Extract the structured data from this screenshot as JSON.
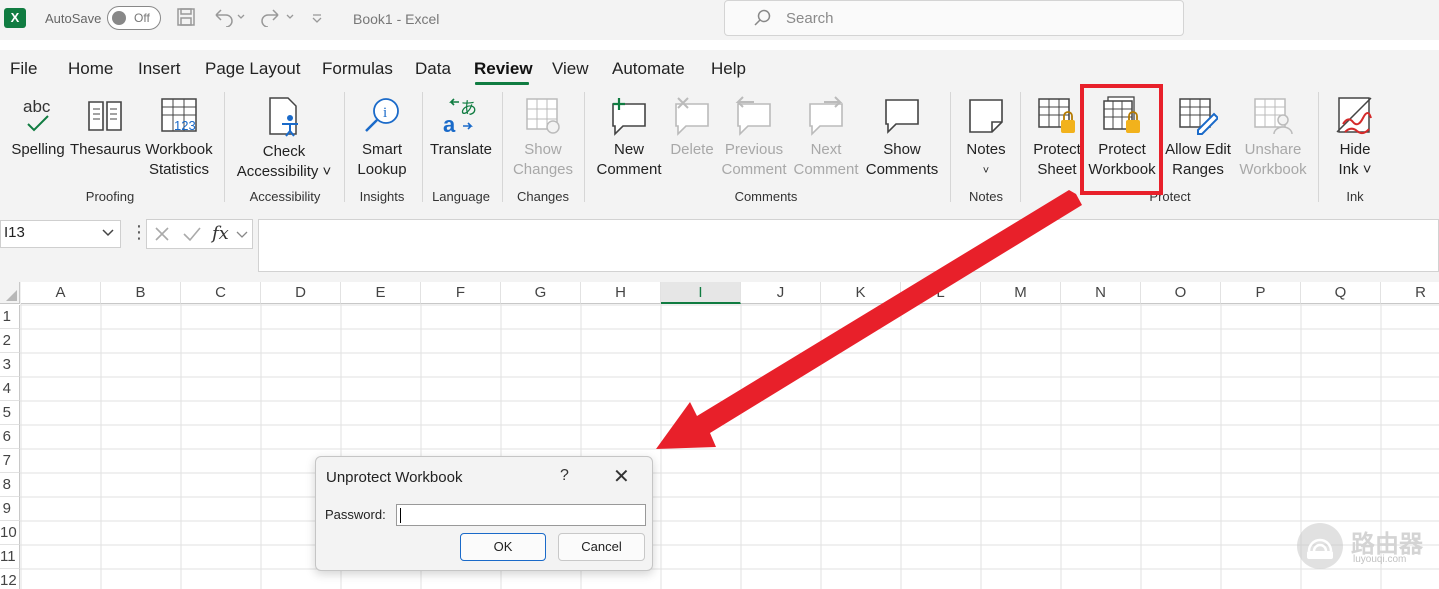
{
  "titlebar": {
    "app_icon": "X",
    "autosave_label": "AutoSave",
    "autosave_state": "Off",
    "doc_title": "Book1  -  Excel",
    "search_placeholder": "Search"
  },
  "menu": {
    "items": [
      "File",
      "Home",
      "Insert",
      "Page Layout",
      "Formulas",
      "Data",
      "Review",
      "View",
      "Automate",
      "Help"
    ],
    "active": "Review"
  },
  "ribbon": {
    "spelling": "Spelling",
    "thesaurus": "Thesaurus",
    "workbook_stats_1": "Workbook",
    "workbook_stats_2": "Statistics",
    "check_acc_1": "Check",
    "check_acc_2": "Accessibility ˅",
    "smart_1": "Smart",
    "smart_2": "Lookup",
    "translate": "Translate",
    "show_changes_1": "Show",
    "show_changes_2": "Changes",
    "new_comment_1": "New",
    "new_comment_2": "Comment",
    "delete": "Delete",
    "prev_1": "Previous",
    "prev_2": "Comment",
    "next_1": "Next",
    "next_2": "Comment",
    "show_comments_1": "Show",
    "show_comments_2": "Comments",
    "notes": "Notes",
    "protect_sheet_1": "Protect",
    "protect_sheet_2": "Sheet",
    "protect_wb_1": "Protect",
    "protect_wb_2": "Workbook",
    "allow_edit_1": "Allow Edit",
    "allow_edit_2": "Ranges",
    "unshare_1": "Unshare",
    "unshare_2": "Workbook",
    "hide_ink_1": "Hide",
    "hide_ink_2": "Ink ˅",
    "groups": {
      "proofing": "Proofing",
      "accessibility": "Accessibility",
      "insights": "Insights",
      "language": "Language",
      "changes": "Changes",
      "comments": "Comments",
      "notes": "Notes",
      "protect": "Protect",
      "ink": "Ink"
    }
  },
  "formula_bar": {
    "name_box": "I13",
    "fx": "fx"
  },
  "grid": {
    "columns": [
      "A",
      "B",
      "C",
      "D",
      "E",
      "F",
      "G",
      "H",
      "I",
      "J",
      "K",
      "L",
      "M",
      "N",
      "O",
      "P",
      "Q",
      "R"
    ],
    "selected_column": "I",
    "rows": [
      "1",
      "2",
      "3",
      "4",
      "5",
      "6",
      "7",
      "8",
      "9",
      "10",
      "11",
      "12"
    ]
  },
  "dialog": {
    "title": "Unprotect Workbook",
    "help": "?",
    "close": "✕",
    "password_label": "Password:",
    "password_value": "",
    "ok": "OK",
    "cancel": "Cancel"
  },
  "watermark": {
    "text": "路由器",
    "sub": "luyouqi.com"
  },
  "colors": {
    "excel_green": "#107c41",
    "highlight_red": "#e8202a",
    "accent_blue": "#1a6ac9"
  }
}
